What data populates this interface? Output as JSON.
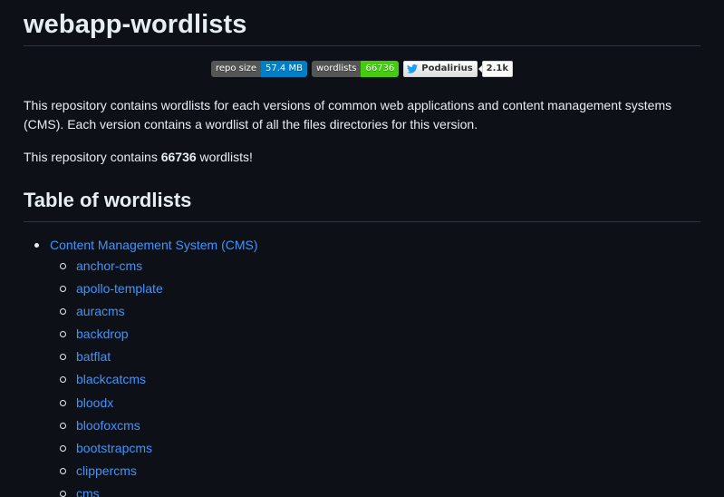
{
  "title": "webapp-wordlists",
  "badges": [
    {
      "label": "repo size",
      "value": "57.4 MB",
      "color": "#007ec6"
    },
    {
      "label": "wordlists",
      "value": "66736",
      "color": "#44cc11"
    }
  ],
  "social": {
    "label": "Podalirius",
    "count": "2.1k",
    "icon": "twitter-bird-icon"
  },
  "intro": "This repository contains wordlists for each versions of common web applications and content management systems (CMS). Each version contains a wordlist of all the files directories for this version.",
  "count_line": {
    "prefix": "This repository contains ",
    "count": "66736",
    "suffix": " wordlists!"
  },
  "toc_heading": "Table of wordlists",
  "toc": {
    "category": "Content Management System (CMS)",
    "items": [
      "anchor-cms",
      "apollo-template",
      "auracms",
      "backdrop",
      "batflat",
      "blackcatcms",
      "bloodx",
      "bloofoxcms",
      "bootstrapcms",
      "clippercms",
      "cms"
    ]
  },
  "colors": {
    "background": "#0d1117",
    "text": "#e6edf3",
    "link": "#4493f8",
    "border": "#30363d"
  }
}
